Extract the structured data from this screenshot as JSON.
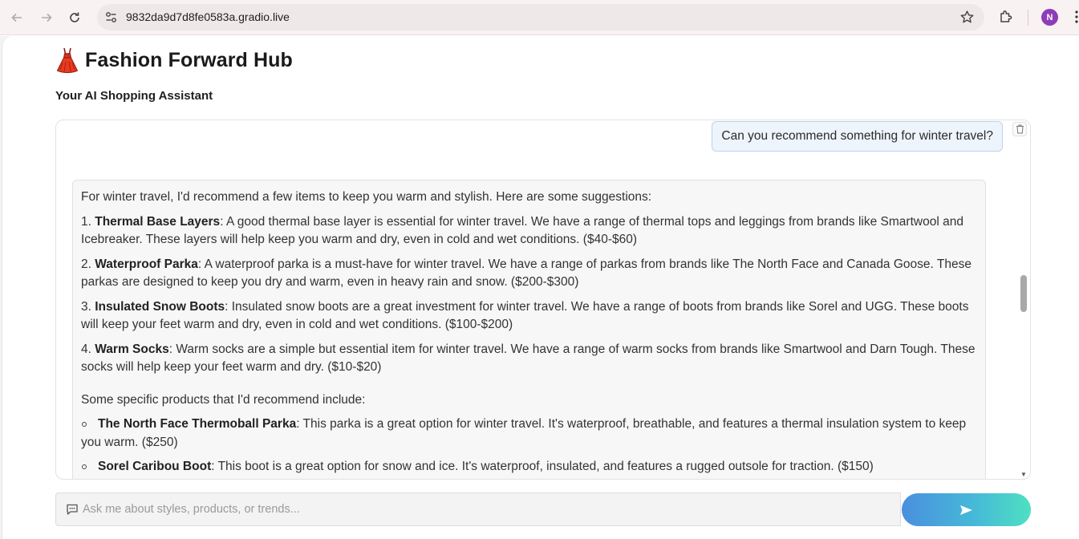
{
  "browser": {
    "url": "9832da9d7d8fe0583a.gradio.live",
    "profile_initial": "N",
    "profile_color": "#8e3db8"
  },
  "app": {
    "title_emoji": "dress-icon",
    "title": "Fashion Forward Hub",
    "subtitle": "Your AI Shopping Assistant"
  },
  "chat": {
    "user_message": "Can you recommend something for winter travel?",
    "bot": {
      "intro": "For winter travel, I'd recommend a few items to keep you warm and stylish. Here are some suggestions:",
      "numbered": [
        {
          "num": "1. ",
          "name": "Thermal Base Layers",
          "text": ": A good thermal base layer is essential for winter travel. We have a range of thermal tops and leggings from brands like Smartwool and Icebreaker. These layers will help keep you warm and dry, even in cold and wet conditions. ($40-$60)"
        },
        {
          "num": "2. ",
          "name": "Waterproof Parka",
          "text": ": A waterproof parka is a must-have for winter travel. We have a range of parkas from brands like The North Face and Canada Goose. These parkas are designed to keep you dry and warm, even in heavy rain and snow. ($200-$300)"
        },
        {
          "num": "3. ",
          "name": "Insulated Snow Boots",
          "text": ": Insulated snow boots are a great investment for winter travel. We have a range of boots from brands like Sorel and UGG. These boots will keep your feet warm and dry, even in cold and wet conditions. ($100-$200)"
        },
        {
          "num": "4. ",
          "name": "Warm Socks",
          "text": ": Warm socks are a simple but essential item for winter travel. We have a range of warm socks from brands like Smartwool and Darn Tough. These socks will help keep your feet warm and dry. ($10-$20)"
        }
      ],
      "products_intro": "Some specific products that I'd recommend include:",
      "products": [
        {
          "name": "The North Face Thermoball Parka",
          "text": ": This parka is a great option for winter travel. It's waterproof, breathable, and features a thermal insulation system to keep you warm. ($250)"
        },
        {
          "name": "Sorel Caribou Boot",
          "text": ": This boot is a great option for snow and ice. It's waterproof, insulated, and features a rugged outsole for traction. ($150)"
        }
      ]
    }
  },
  "input": {
    "placeholder": "Ask me about styles, products, or trends..."
  }
}
